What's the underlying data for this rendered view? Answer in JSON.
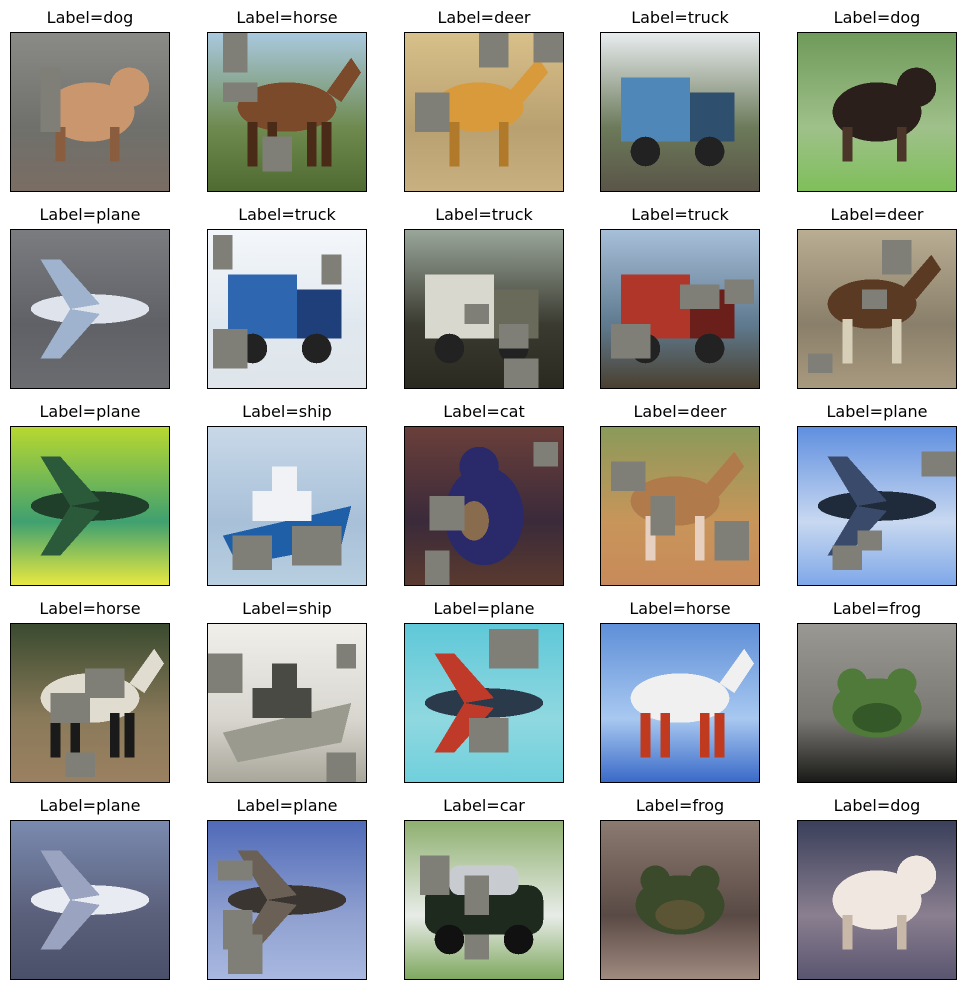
{
  "figure": {
    "mask_color": "#7f7f77",
    "cells": [
      {
        "label": "Label=dog",
        "subject": "dog",
        "colors": {
          "bg": "#8a8a86",
          "bg2": "#6f706c",
          "fg": "#c9966e",
          "fg2": "#8a5d3f",
          "ground": "#7a6d63"
        }
      },
      {
        "label": "Label=horse",
        "subject": "horse",
        "colors": {
          "bg": "#a9c9df",
          "bg2": "#6f8a4f",
          "fg": "#7a4a2b",
          "fg2": "#4a2b18",
          "ground": "#4f6b31"
        }
      },
      {
        "label": "Label=deer",
        "subject": "deer",
        "colors": {
          "bg": "#d8c08a",
          "bg2": "#b9a070",
          "fg": "#d89a3a",
          "fg2": "#b07a2a",
          "ground": "#c8b080"
        }
      },
      {
        "label": "Label=truck",
        "subject": "truck",
        "colors": {
          "bg": "#e8ecef",
          "bg2": "#6c7a5a",
          "fg": "#4f87b8",
          "fg2": "#2f4f6f",
          "ground": "#5a5548"
        }
      },
      {
        "label": "Label=dog",
        "subject": "dog",
        "colors": {
          "bg": "#6f9a5a",
          "bg2": "#9fc08a",
          "fg": "#2a1f1a",
          "fg2": "#4a3528",
          "ground": "#7fbf5a"
        }
      },
      {
        "label": "Label=plane",
        "subject": "plane",
        "colors": {
          "bg": "#7a7c80",
          "bg2": "#5f6166",
          "fg": "#dfe3ec",
          "fg2": "#9fb3cf",
          "ground": "#6a6c70"
        }
      },
      {
        "label": "Label=truck",
        "subject": "truck",
        "colors": {
          "bg": "#f4f7fa",
          "bg2": "#e0e8ef",
          "fg": "#2f66b0",
          "fg2": "#1f3f7a",
          "ground": "#dfe5ea"
        }
      },
      {
        "label": "Label=truck",
        "subject": "truck",
        "colors": {
          "bg": "#9aa69a",
          "bg2": "#3a3a30",
          "fg": "#d8d8cf",
          "fg2": "#6a6a5a",
          "ground": "#2a2a20"
        }
      },
      {
        "label": "Label=truck",
        "subject": "truck",
        "colors": {
          "bg": "#a7bfd9",
          "bg2": "#5f7a8f",
          "fg": "#b0362a",
          "fg2": "#6a1f1a",
          "ground": "#4a4030"
        }
      },
      {
        "label": "Label=deer",
        "subject": "deer",
        "colors": {
          "bg": "#b9ad93",
          "bg2": "#8a7f6a",
          "fg": "#5a3a22",
          "fg2": "#d8cfb8",
          "ground": "#a89a7f"
        }
      },
      {
        "label": "Label=plane",
        "subject": "plane",
        "colors": {
          "bg": "#b8d830",
          "bg2": "#3fa070",
          "fg": "#1f3f2a",
          "fg2": "#2a5a3a",
          "ground": "#e8e840"
        }
      },
      {
        "label": "Label=ship",
        "subject": "ship",
        "colors": {
          "bg": "#c8d8e8",
          "bg2": "#a8c0d8",
          "fg": "#f0f2f5",
          "fg2": "#1f5fa8",
          "ground": "#b8cfe0"
        }
      },
      {
        "label": "Label=cat",
        "subject": "cat",
        "colors": {
          "bg": "#6a3f3a",
          "bg2": "#3a2a3a",
          "fg": "#2a2a6a",
          "fg2": "#c89a3a",
          "ground": "#5a3a2f"
        }
      },
      {
        "label": "Label=deer",
        "subject": "deer",
        "colors": {
          "bg": "#8a9a5a",
          "bg2": "#c8955a",
          "fg": "#b07a4a",
          "fg2": "#e8d0c0",
          "ground": "#c88a5a"
        }
      },
      {
        "label": "Label=plane",
        "subject": "plane",
        "colors": {
          "bg": "#5f8fe0",
          "bg2": "#c8d8f0",
          "fg": "#1f2a3a",
          "fg2": "#3a4a6a",
          "ground": "#7fa8e8"
        }
      },
      {
        "label": "Label=horse",
        "subject": "horse",
        "colors": {
          "bg": "#3a4a2f",
          "bg2": "#8a7a5a",
          "fg": "#e0dcd0",
          "fg2": "#1a1a1a",
          "ground": "#9a8060"
        }
      },
      {
        "label": "Label=ship",
        "subject": "ship",
        "colors": {
          "bg": "#f0efea",
          "bg2": "#d8d6cf",
          "fg": "#4a4a45",
          "fg2": "#9a9a8f",
          "ground": "#a9a79a"
        }
      },
      {
        "label": "Label=plane",
        "subject": "plane",
        "colors": {
          "bg": "#5fc8d8",
          "bg2": "#8fd8e0",
          "fg": "#2a3a4a",
          "fg2": "#c03a2a",
          "ground": "#6fd0dc"
        }
      },
      {
        "label": "Label=horse",
        "subject": "horse",
        "colors": {
          "bg": "#5f8fd8",
          "bg2": "#a8c8f0",
          "fg": "#f0f0f0",
          "fg2": "#c03a1f",
          "ground": "#3a6ac8"
        }
      },
      {
        "label": "Label=frog",
        "subject": "frog",
        "colors": {
          "bg": "#9a9893",
          "bg2": "#7a7873",
          "fg": "#4f7a3a",
          "fg2": "#2a4a1f",
          "ground": "#1a1a18"
        }
      },
      {
        "label": "Label=plane",
        "subject": "plane",
        "colors": {
          "bg": "#7a8aaf",
          "bg2": "#5a5f7a",
          "fg": "#e8ecf2",
          "fg2": "#9aa3bf",
          "ground": "#4a4f6a"
        }
      },
      {
        "label": "Label=plane",
        "subject": "plane",
        "colors": {
          "bg": "#4f6ab8",
          "bg2": "#8fa0d0",
          "fg": "#3a3530",
          "fg2": "#6a6055",
          "ground": "#a8b8e0"
        }
      },
      {
        "label": "Label=car",
        "subject": "car",
        "colors": {
          "bg": "#8fb070",
          "bg2": "#e8ece8",
          "fg": "#1f2a1f",
          "fg2": "#c8ccd0",
          "ground": "#7fa85f"
        }
      },
      {
        "label": "Label=frog",
        "subject": "frog",
        "colors": {
          "bg": "#8a7a70",
          "bg2": "#5a4a45",
          "fg": "#3a4a2a",
          "fg2": "#6a5a3a",
          "ground": "#a08a80"
        }
      },
      {
        "label": "Label=dog",
        "subject": "dog",
        "colors": {
          "bg": "#3a3f5a",
          "bg2": "#8a7f90",
          "fg": "#f0e8e0",
          "fg2": "#c8b8a8",
          "ground": "#5a5570"
        }
      }
    ]
  }
}
